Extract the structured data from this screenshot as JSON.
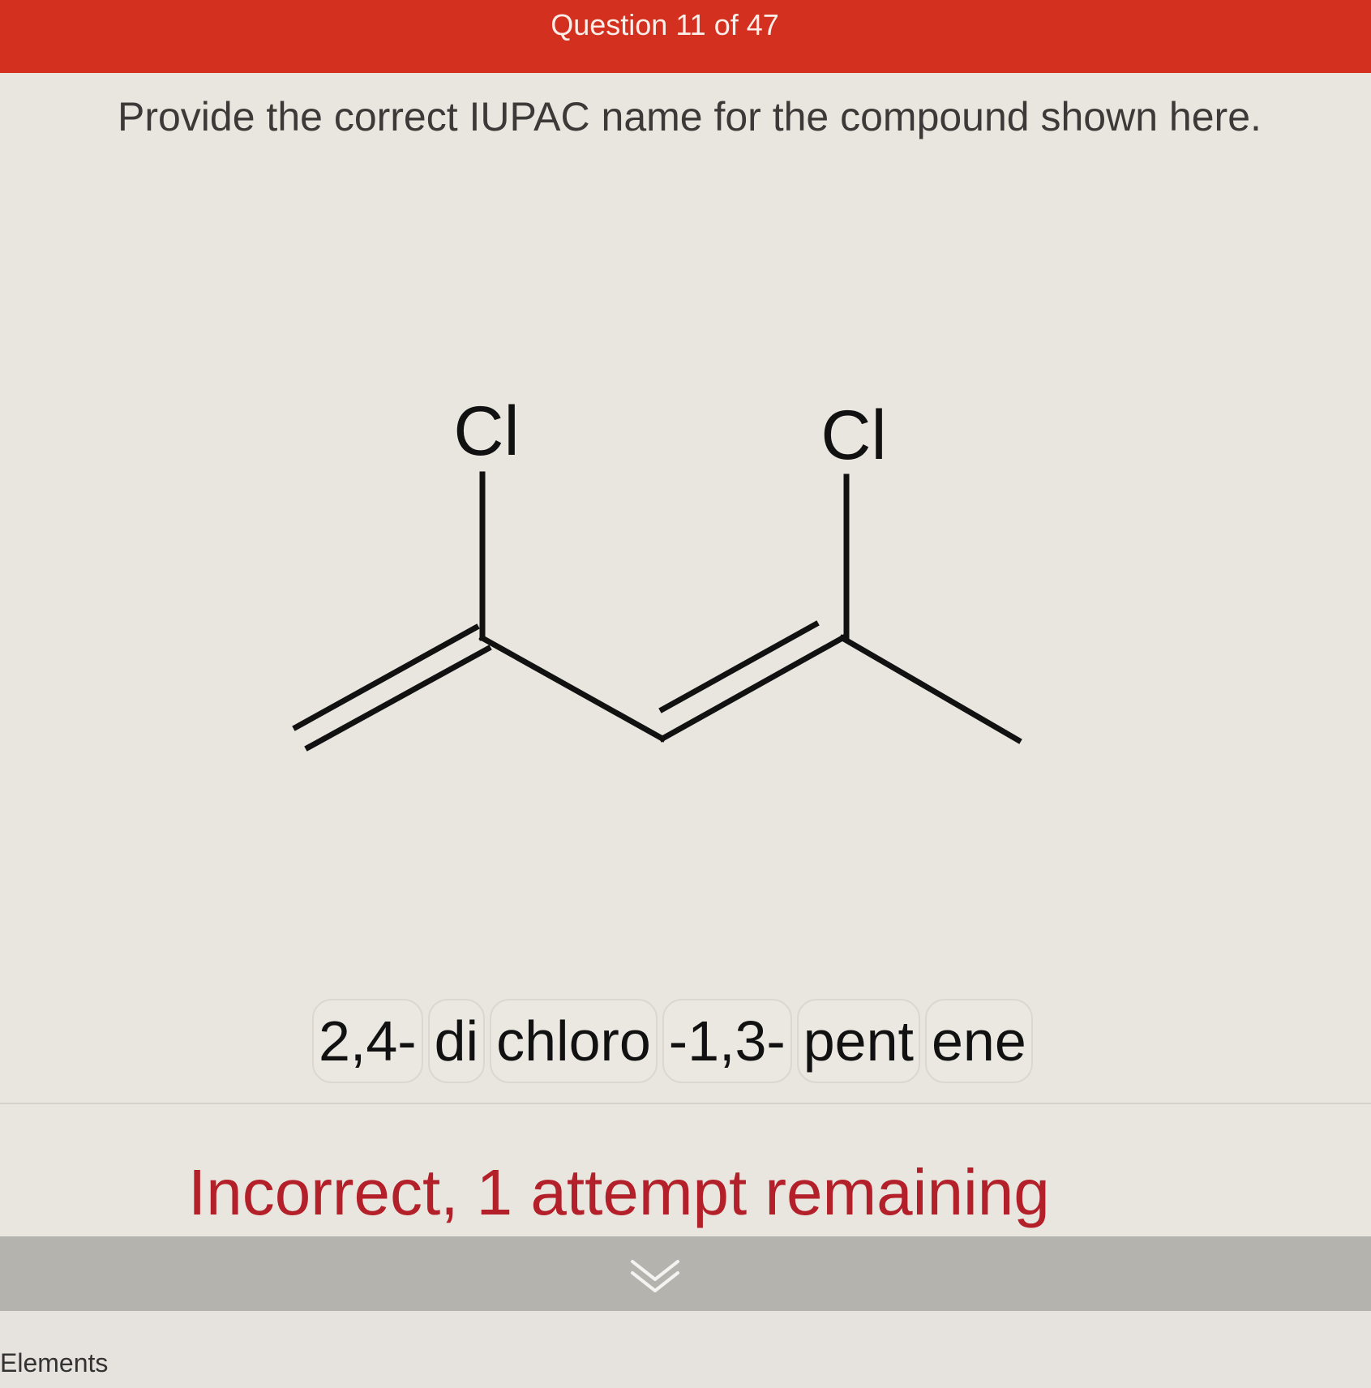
{
  "header": {
    "title": "Question 11 of 47",
    "color": "#d3301f"
  },
  "question": {
    "prompt": "Provide the correct IUPAC name for the compound shown here."
  },
  "structure": {
    "atom_labels": [
      "Cl",
      "Cl"
    ]
  },
  "answer": {
    "tokens": [
      "2,4-",
      "di",
      "chloro",
      "-1,3-",
      "pent",
      "ene"
    ]
  },
  "feedback": {
    "message": "Incorrect, 1 attempt remaining",
    "color": "#b3202a"
  },
  "collapse": {
    "icon": "double-chevron-down-icon"
  },
  "sidebar": {
    "label": "Elements"
  }
}
